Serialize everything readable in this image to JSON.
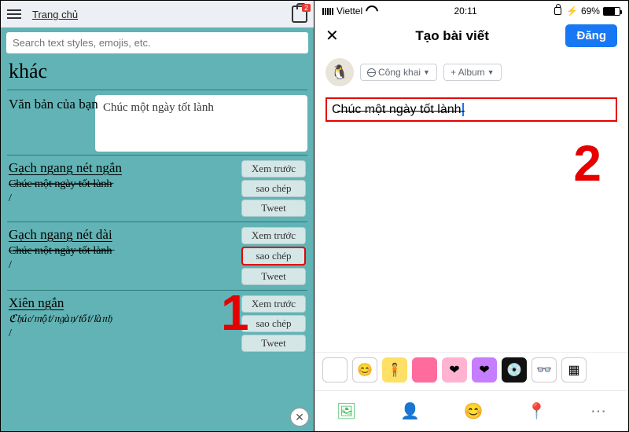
{
  "annotations": {
    "step1": "1",
    "step2": "2"
  },
  "left": {
    "home_label": "Trang chủ",
    "badge": "2",
    "search_placeholder": "Search text styles, emojis, etc.",
    "heading": "khác",
    "input_label": "Văn bản của bạn",
    "input_value": "Chúc một ngày tốt lành",
    "styles": [
      {
        "title": "Gạch ngang nét ngắn",
        "sample": "C̵h̵ú̵c̵ ̵m̵ộ̵t̵ ̵n̵g̵à̵y̵ ̵t̵ố̵t̵ ̵l̵à̵n̵h̵",
        "slash": "/"
      },
      {
        "title": "Gạch ngang nét dài",
        "sample": "C̶h̶ú̶c̶ ̶m̶ộ̶t̶ ̶n̶g̶à̶y̶ ̶t̶ố̶t̶ ̶l̶à̶n̶h̶",
        "slash": "/"
      },
      {
        "title": "Xiên ngắn",
        "sample": "ℭ𝔥ú𝔠/𝔪ộ𝔱/𝔫𝔤à𝔶/𝔱ố𝔱/𝔩à𝔫𝔥",
        "slash": "/"
      }
    ],
    "buttons": {
      "preview": "Xem trước",
      "copy": "sao chép",
      "tweet": "Tweet"
    }
  },
  "right": {
    "status": {
      "carrier": "Viettel",
      "time": "20:11",
      "battery_pct": "69%",
      "charging": "⚡"
    },
    "nav": {
      "title": "Tạo bài viết",
      "post": "Đăng"
    },
    "audience": "Công khai",
    "album": "+ Album",
    "compose_text": "C̶h̶ú̶c̶ ̶m̶ộ̶t̶ ̶n̶g̶à̶y̶ ̶t̶ố̶t̶ ̶l̶à̶n̶h̶",
    "bg": [
      {
        "c": "#fff",
        "e": ""
      },
      {
        "c": "#fff",
        "e": "😊"
      },
      {
        "c": "#ffe066",
        "e": "🧍"
      },
      {
        "c": "#ff6b9d",
        "e": ""
      },
      {
        "c": "#ffb3d1",
        "e": "❤"
      },
      {
        "c": "#c77dff",
        "e": "❤"
      },
      {
        "c": "#111",
        "e": "💿"
      },
      {
        "c": "#fff",
        "e": "👓"
      },
      {
        "c": "#fff",
        "e": "▦"
      }
    ],
    "bar_colors": {
      "photo": "#45bd62",
      "tag": "#1877f2",
      "emoji": "#f7b928",
      "location": "#f5533d",
      "more": "#888"
    }
  }
}
